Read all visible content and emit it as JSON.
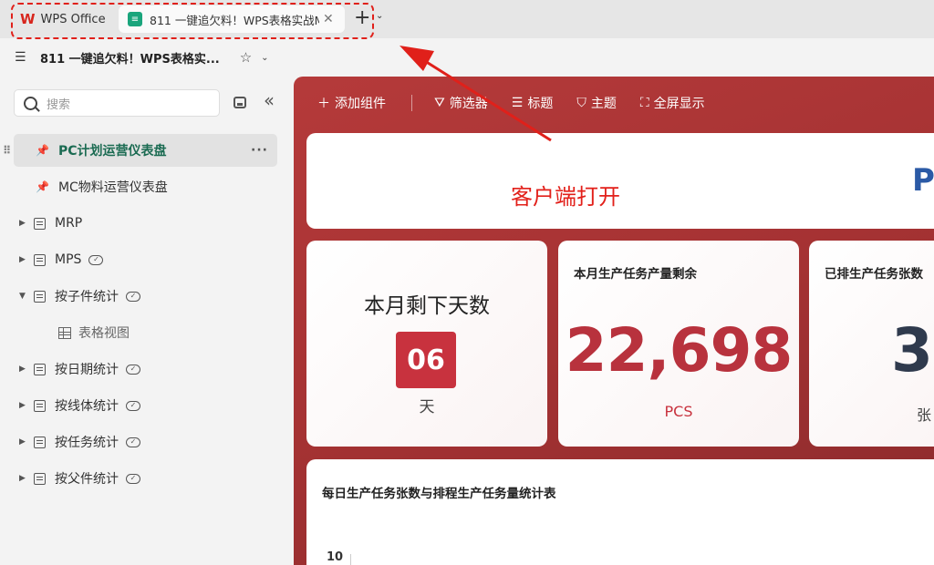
{
  "tabs": {
    "wps_label": "WPS Office",
    "doc_label": "811 一键追欠料！WPS表格实战M",
    "close_glyph": "✕",
    "new_tab_glyph": "+",
    "more_glyph": "⌄"
  },
  "titlebar": {
    "doc_name": "811 一键追欠料！WPS表格实..."
  },
  "sidebar": {
    "search_placeholder": "搜索",
    "items": [
      {
        "label": "PC计划运营仪表盘",
        "type": "dashboard",
        "active": true
      },
      {
        "label": "MC物料运营仪表盘",
        "type": "dashboard",
        "active": false
      },
      {
        "label": "MRP",
        "type": "sheet",
        "expanded": false
      },
      {
        "label": "MPS",
        "type": "sheet",
        "expanded": false,
        "synced": true
      },
      {
        "label": "按子件统计",
        "type": "sheet",
        "expanded": true,
        "synced": true
      },
      {
        "label": "表格视图",
        "type": "view"
      },
      {
        "label": "按日期统计",
        "type": "sheet",
        "expanded": false,
        "synced": true
      },
      {
        "label": "按线体统计",
        "type": "sheet",
        "expanded": false,
        "synced": true
      },
      {
        "label": "按任务统计",
        "type": "sheet",
        "expanded": false,
        "synced": true
      },
      {
        "label": "按父件统计",
        "type": "sheet",
        "expanded": false,
        "synced": true
      }
    ]
  },
  "toolbar": {
    "add_widget": "添加组件",
    "filter": "筛选器",
    "title": "标题",
    "theme": "主题",
    "fullscreen": "全屏显示"
  },
  "dashboard": {
    "client_open": "客户端打开",
    "title_partial": "P",
    "card1": {
      "title": "本月剩下天数",
      "value": "06",
      "unit": "天"
    },
    "card2": {
      "title": "本月生产任务产量剩余",
      "value": "22,698",
      "unit": "PCS"
    },
    "card3": {
      "title": "已排生产任务张数",
      "value": "3",
      "unit": "张"
    },
    "chart": {
      "title": "每日生产任务张数与排程生产任务量统计表",
      "y_tick": "10"
    }
  },
  "colors": {
    "accent_red": "#c8323e",
    "dashboard_bg": "#a53233",
    "annotation_red": "#e0201a",
    "active_text": "#1b6b52"
  }
}
